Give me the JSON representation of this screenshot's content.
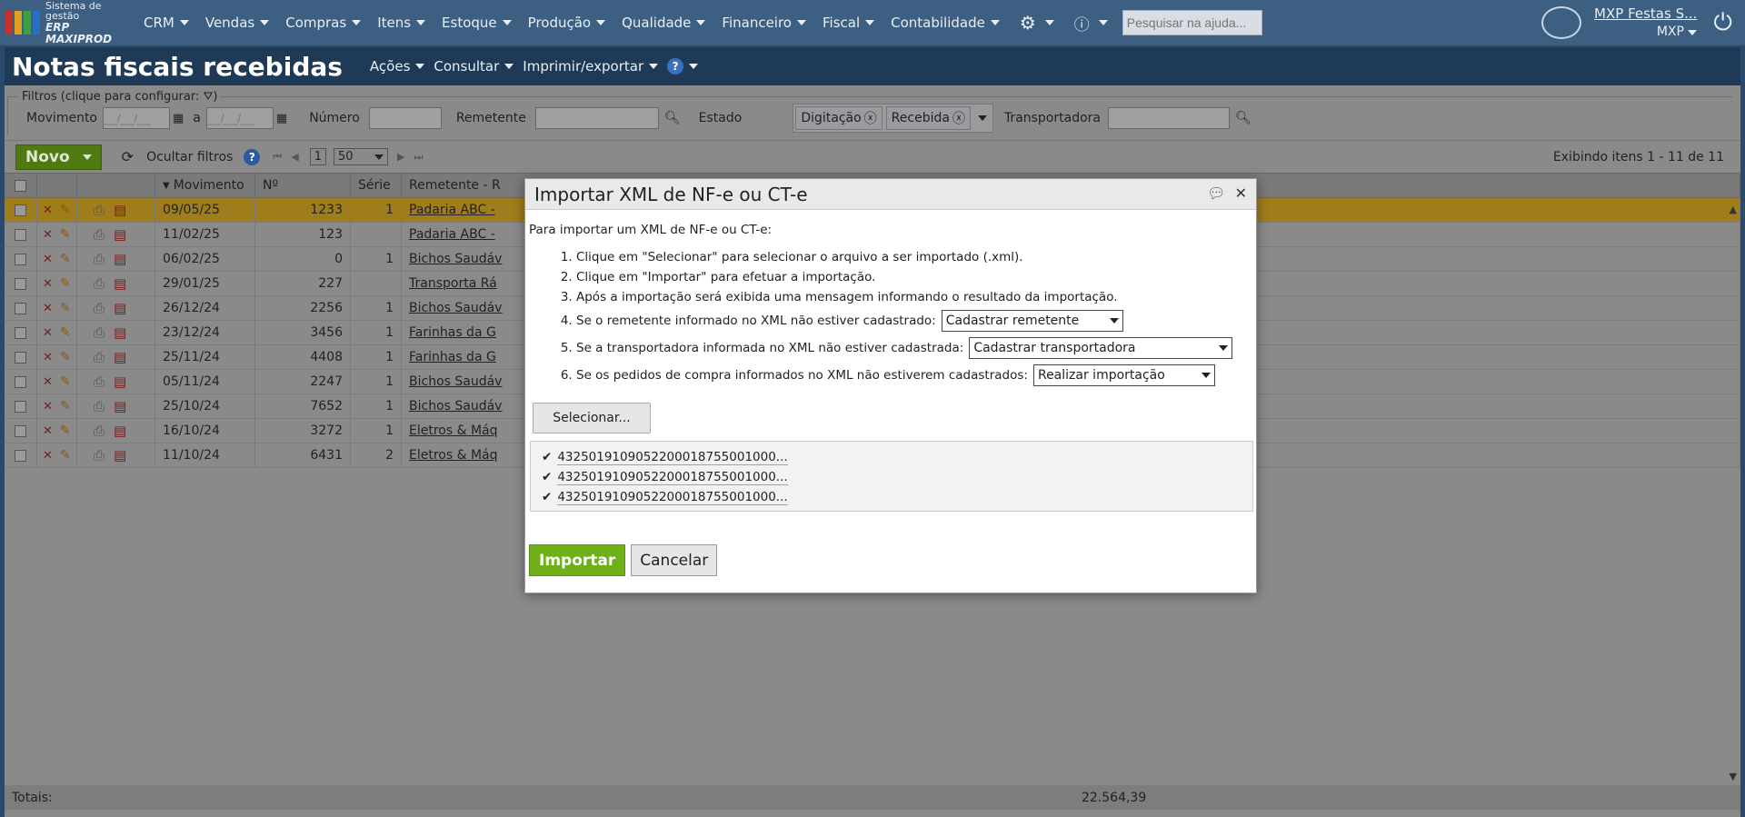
{
  "app": {
    "logo_line1": "Sistema de gestão",
    "logo_line2": "ERP MAXIPROD",
    "menu": [
      {
        "label": "CRM"
      },
      {
        "label": "Vendas"
      },
      {
        "label": "Compras"
      },
      {
        "label": "Itens"
      },
      {
        "label": "Estoque"
      },
      {
        "label": "Produção"
      },
      {
        "label": "Qualidade"
      },
      {
        "label": "Financeiro"
      },
      {
        "label": "Fiscal"
      },
      {
        "label": "Contabilidade"
      }
    ],
    "help_search_placeholder": "Pesquisar na ajuda...",
    "user_name": "MXP Festas S...",
    "user_short": "MXP"
  },
  "page": {
    "title": "Notas fiscais recebidas",
    "menu": {
      "acoes": "Ações",
      "consultar": "Consultar",
      "imprimir": "Imprimir/exportar"
    },
    "filters": {
      "legend": "Filtros (clique para configurar:",
      "movimento_label": "Movimento",
      "date_placeholder": "__/__/__",
      "a_label": "a",
      "numero_label": "Número",
      "remetente_label": "Remetente",
      "estado_label": "Estado",
      "estado_chips": [
        "Digitação",
        "Recebida"
      ],
      "transportadora_label": "Transportadora"
    },
    "toolbar": {
      "novo": "Novo",
      "ocultar": "Ocultar filtros",
      "page": "1",
      "page_size": "50",
      "exibindo": "Exibindo itens 1 - 11 de 11"
    },
    "grid": {
      "headers": {
        "movimento": "Movimento",
        "numero": "Nº",
        "serie": "Série",
        "remetente": "Remetente - R"
      },
      "rows": [
        {
          "movimento": "09/05/25",
          "numero": "1233",
          "serie": "1",
          "remetente": "Padaria ABC -"
        },
        {
          "movimento": "11/02/25",
          "numero": "123",
          "serie": "",
          "remetente": "Padaria ABC -"
        },
        {
          "movimento": "06/02/25",
          "numero": "0",
          "serie": "1",
          "remetente": "Bichos Saudáv"
        },
        {
          "movimento": "29/01/25",
          "numero": "227",
          "serie": "",
          "remetente": "Transporta Rá"
        },
        {
          "movimento": "26/12/24",
          "numero": "2256",
          "serie": "1",
          "remetente": "Bichos Saudáv"
        },
        {
          "movimento": "23/12/24",
          "numero": "3456",
          "serie": "1",
          "remetente": "Farinhas da G"
        },
        {
          "movimento": "25/11/24",
          "numero": "4408",
          "serie": "1",
          "remetente": "Farinhas da G"
        },
        {
          "movimento": "05/11/24",
          "numero": "2247",
          "serie": "1",
          "remetente": "Bichos Saudáv"
        },
        {
          "movimento": "25/10/24",
          "numero": "7652",
          "serie": "1",
          "remetente": "Bichos Saudáv"
        },
        {
          "movimento": "16/10/24",
          "numero": "3272",
          "serie": "1",
          "remetente": "Eletros & Máq"
        },
        {
          "movimento": "11/10/24",
          "numero": "6431",
          "serie": "2",
          "remetente": "Eletros & Máq"
        }
      ],
      "totals_label": "Totais:",
      "totals_value": "22.564,39"
    }
  },
  "modal": {
    "title": "Importar XML de NF-e ou CT-e",
    "intro": "Para importar um XML de NF-e ou CT-e:",
    "steps": {
      "s1": "Clique em \"Selecionar\" para selecionar o arquivo a ser importado (.xml).",
      "s2": "Clique em \"Importar\" para efetuar a importação.",
      "s3": "Após a importação será exibida uma mensagem informando o resultado da importação.",
      "s4": "Se o remetente informado no XML não estiver cadastrado:",
      "s5": "Se a transportadora informada no XML não estiver cadastrada:",
      "s6": "Se os pedidos de compra informados no XML não estiverem cadastrados:"
    },
    "selects": {
      "remetente": "Cadastrar remetente",
      "transportadora": "Cadastrar transportadora",
      "pedidos": "Realizar importação"
    },
    "selecionar": "Selecionar...",
    "files": [
      "4325019109052200018755001000...",
      "4325019109052200018755001000...",
      "4325019109052200018755001000..."
    ],
    "importar": "Importar",
    "cancelar": "Cancelar"
  }
}
